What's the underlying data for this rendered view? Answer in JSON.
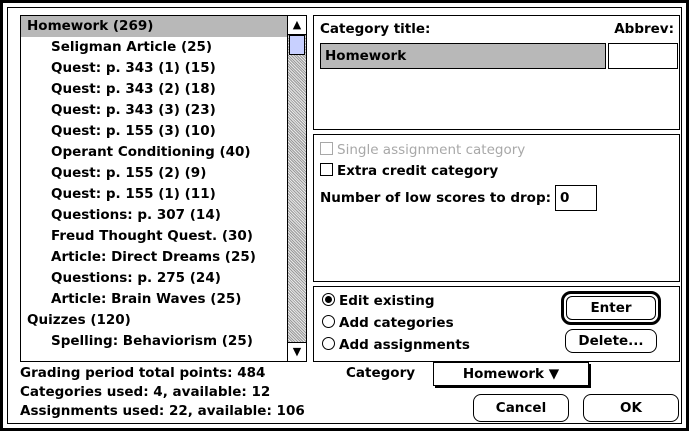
{
  "list": {
    "items": [
      {
        "label": "Homework (269)",
        "indent": false,
        "selected": true
      },
      {
        "label": "Seligman Article (25)",
        "indent": true
      },
      {
        "label": "Quest: p. 343 (1) (15)",
        "indent": true
      },
      {
        "label": "Quest: p. 343 (2) (18)",
        "indent": true
      },
      {
        "label": "Quest: p. 343 (3) (23)",
        "indent": true
      },
      {
        "label": "Quest: p. 155 (3) (10)",
        "indent": true
      },
      {
        "label": "Operant Conditioning (40)",
        "indent": true
      },
      {
        "label": "Quest: p. 155 (2) (9)",
        "indent": true
      },
      {
        "label": "Quest: p. 155 (1) (11)",
        "indent": true
      },
      {
        "label": "Questions: p. 307 (14)",
        "indent": true
      },
      {
        "label": "Freud Thought Quest. (30)",
        "indent": true
      },
      {
        "label": "Article: Direct Dreams (25)",
        "indent": true
      },
      {
        "label": "Questions: p. 275 (24)",
        "indent": true
      },
      {
        "label": "Article: Brain Waves (25)",
        "indent": true
      },
      {
        "label": "Quizzes (120)",
        "indent": false
      },
      {
        "label": "Spelling: Behaviorism (25)",
        "indent": true
      }
    ]
  },
  "category": {
    "title_label": "Category title:",
    "abbrev_label": "Abbrev:",
    "title_value": "Homework",
    "abbrev_value": ""
  },
  "options": {
    "single_assignment": "Single assignment category",
    "extra_credit": "Extra credit category",
    "drop_label": "Number of low scores to drop:",
    "drop_value": "0"
  },
  "mode": {
    "edit_existing": "Edit existing",
    "add_categories": "Add categories",
    "add_assignments": "Add assignments",
    "selected": "edit_existing"
  },
  "buttons": {
    "enter": "Enter",
    "delete": "Delete...",
    "cancel": "Cancel",
    "ok": "OK"
  },
  "status": {
    "total_points": "Grading period total points: 484",
    "categories_used": "Categories used: 4, available: 12",
    "assignments_used": "Assignments used: 22, available: 106"
  },
  "category_popup": {
    "label": "Category",
    "value": "Homework ▼"
  }
}
